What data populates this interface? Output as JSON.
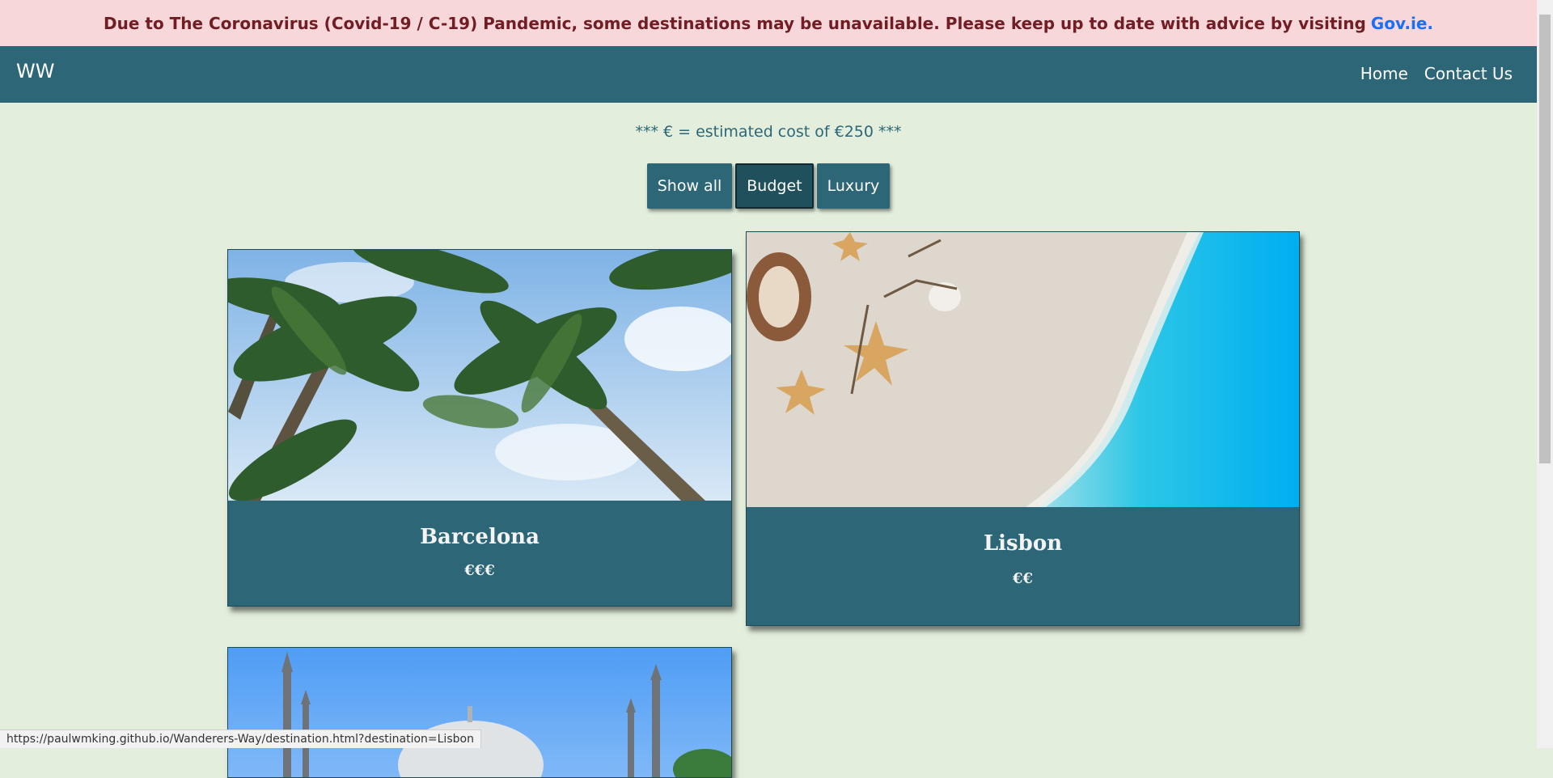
{
  "alert": {
    "message": "Due to The Coronavirus (Covid-19 / C-19) Pandemic, some destinations may be unavailable. Please keep up to date with advice by visiting",
    "link_text": "Gov.ie."
  },
  "navbar": {
    "brand": "WW",
    "links": [
      "Home",
      "Contact Us"
    ]
  },
  "cost_note": "*** € = estimated cost of €250 ***",
  "filters": {
    "buttons": [
      "Show all",
      "Budget",
      "Luxury"
    ],
    "active": "Budget"
  },
  "cards": [
    {
      "title": "Barcelona",
      "price": "€€€",
      "image": "palm-trees-sky"
    },
    {
      "title": "Lisbon",
      "price": "€€",
      "image": "beach-sand-starfish"
    },
    {
      "title": "",
      "price": "",
      "image": "mosque-minarets"
    }
  ],
  "status_bar": {
    "url": "https://paulwmking.github.io/Wanderers-Way/destination.html?destination=Lisbon"
  }
}
